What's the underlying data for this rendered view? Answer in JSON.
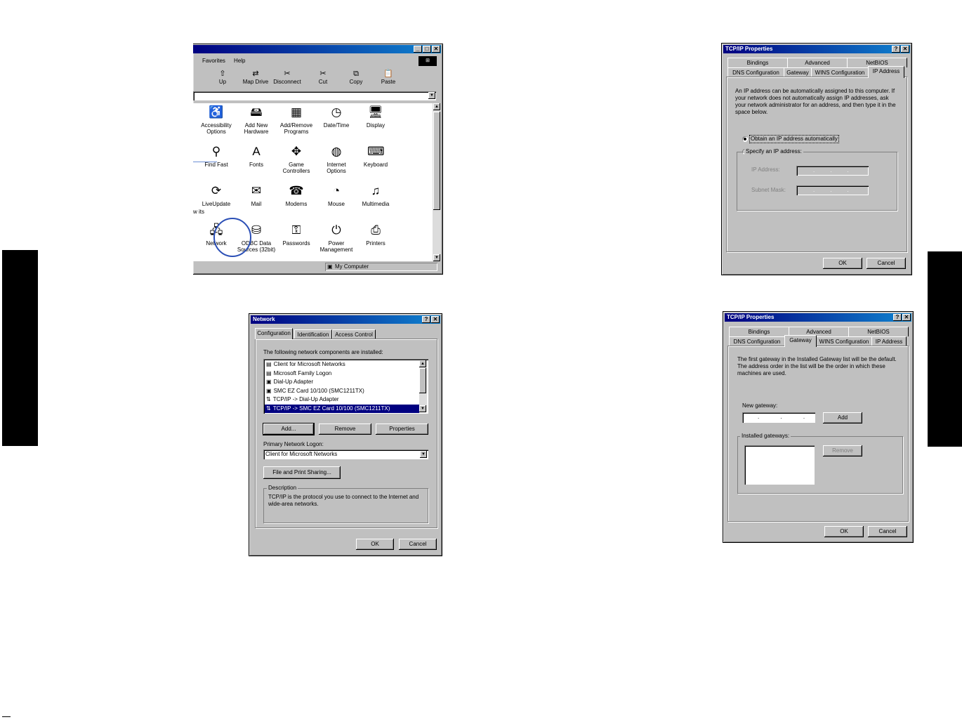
{
  "explorer": {
    "menu": [
      "Favorites",
      "Help"
    ],
    "toolbar": [
      "Up",
      "Map Drive",
      "Disconnect",
      "Cut",
      "Copy",
      "Paste"
    ],
    "address_value": "",
    "left_fragment": "w its",
    "icons": [
      {
        "label": "Accessibility\nOptions",
        "icon": "accessibility-icon",
        "glyph": "♿"
      },
      {
        "label": "Add New\nHardware",
        "icon": "hardware-icon",
        "glyph": "🖴"
      },
      {
        "label": "Add/Remove\nPrograms",
        "icon": "programs-icon",
        "glyph": "▦"
      },
      {
        "label": "Date/Time",
        "icon": "clock-icon",
        "glyph": "◷"
      },
      {
        "label": "Display",
        "icon": "display-icon",
        "glyph": "🖥"
      },
      {
        "label": "Find Fast",
        "icon": "binoculars-icon",
        "glyph": "⚲"
      },
      {
        "label": "Fonts",
        "icon": "fonts-icon",
        "glyph": "A"
      },
      {
        "label": "Game\nControllers",
        "icon": "joystick-icon",
        "glyph": "✥"
      },
      {
        "label": "Internet\nOptions",
        "icon": "globe-icon",
        "glyph": "◍"
      },
      {
        "label": "Keyboard",
        "icon": "keyboard-icon",
        "glyph": "⌨"
      },
      {
        "label": "LiveUpdate",
        "icon": "liveupdate-icon",
        "glyph": "⟳"
      },
      {
        "label": "Mail",
        "icon": "mail-icon",
        "glyph": "✉"
      },
      {
        "label": "Modems",
        "icon": "modem-icon",
        "glyph": "☎"
      },
      {
        "label": "Mouse",
        "icon": "mouse-icon",
        "glyph": "◔"
      },
      {
        "label": "Multimedia",
        "icon": "multimedia-icon",
        "glyph": "♫"
      },
      {
        "label": "Network",
        "icon": "network-icon",
        "glyph": "🖧"
      },
      {
        "label": "ODBC Data\nSources (32bit)",
        "icon": "odbc-icon",
        "glyph": "⛁"
      },
      {
        "label": "Passwords",
        "icon": "key-icon",
        "glyph": "⚿"
      },
      {
        "label": "Power\nManagement",
        "icon": "power-icon",
        "glyph": "⏻"
      },
      {
        "label": "Printers",
        "icon": "printer-icon",
        "glyph": "⎙"
      }
    ],
    "status_text": "My Computer"
  },
  "network": {
    "title": "Network",
    "tabs": [
      "Configuration",
      "Identification",
      "Access Control"
    ],
    "intro": "The following network components are installed:",
    "components": [
      "Client for Microsoft Networks",
      "Microsoft Family Logon",
      "Dial-Up Adapter",
      "SMC EZ Card 10/100 (SMC1211TX)",
      "TCP/IP -> Dial-Up Adapter",
      "TCP/IP -> SMC EZ Card 10/100 (SMC1211TX)"
    ],
    "add": "Add...",
    "remove": "Remove",
    "properties": "Properties",
    "logon_label": "Primary Network Logon:",
    "logon_value": "Client for Microsoft Networks",
    "sharing": "File and Print Sharing...",
    "description_label": "Description",
    "description": "TCP/IP is the protocol you use to connect to the Internet and wide-area networks.",
    "ok": "OK",
    "cancel": "Cancel"
  },
  "tcpip_ip": {
    "title": "TCP/IP Properties",
    "tabs_back": [
      "Bindings",
      "Advanced",
      "NetBIOS"
    ],
    "tabs_front": [
      "DNS Configuration",
      "Gateway",
      "WINS Configuration",
      "IP Address"
    ],
    "text": "An IP address can be automatically assigned to this computer. If your network does not automatically assign IP addresses, ask your network administrator for an address, and then type it in the space below.",
    "radio_auto": "Obtain an IP address automatically",
    "radio_specify": "Specify an IP address:",
    "ip_label": "IP Address:",
    "mask_label": "Subnet Mask:",
    "ok": "OK",
    "cancel": "Cancel"
  },
  "tcpip_gw": {
    "title": "TCP/IP Properties",
    "tabs_back": [
      "Bindings",
      "Advanced",
      "NetBIOS"
    ],
    "tabs_front": [
      "DNS Configuration",
      "Gateway",
      "WINS Configuration",
      "IP Address"
    ],
    "text": "The first gateway in the Installed Gateway list will be the default. The address order in the list will be the order in which these machines are used.",
    "new_gateway_label": "New gateway:",
    "new_gateway_value": ". . .",
    "add": "Add",
    "installed_label": "Installed gateways:",
    "remove": "Remove",
    "ok": "OK",
    "cancel": "Cancel"
  }
}
